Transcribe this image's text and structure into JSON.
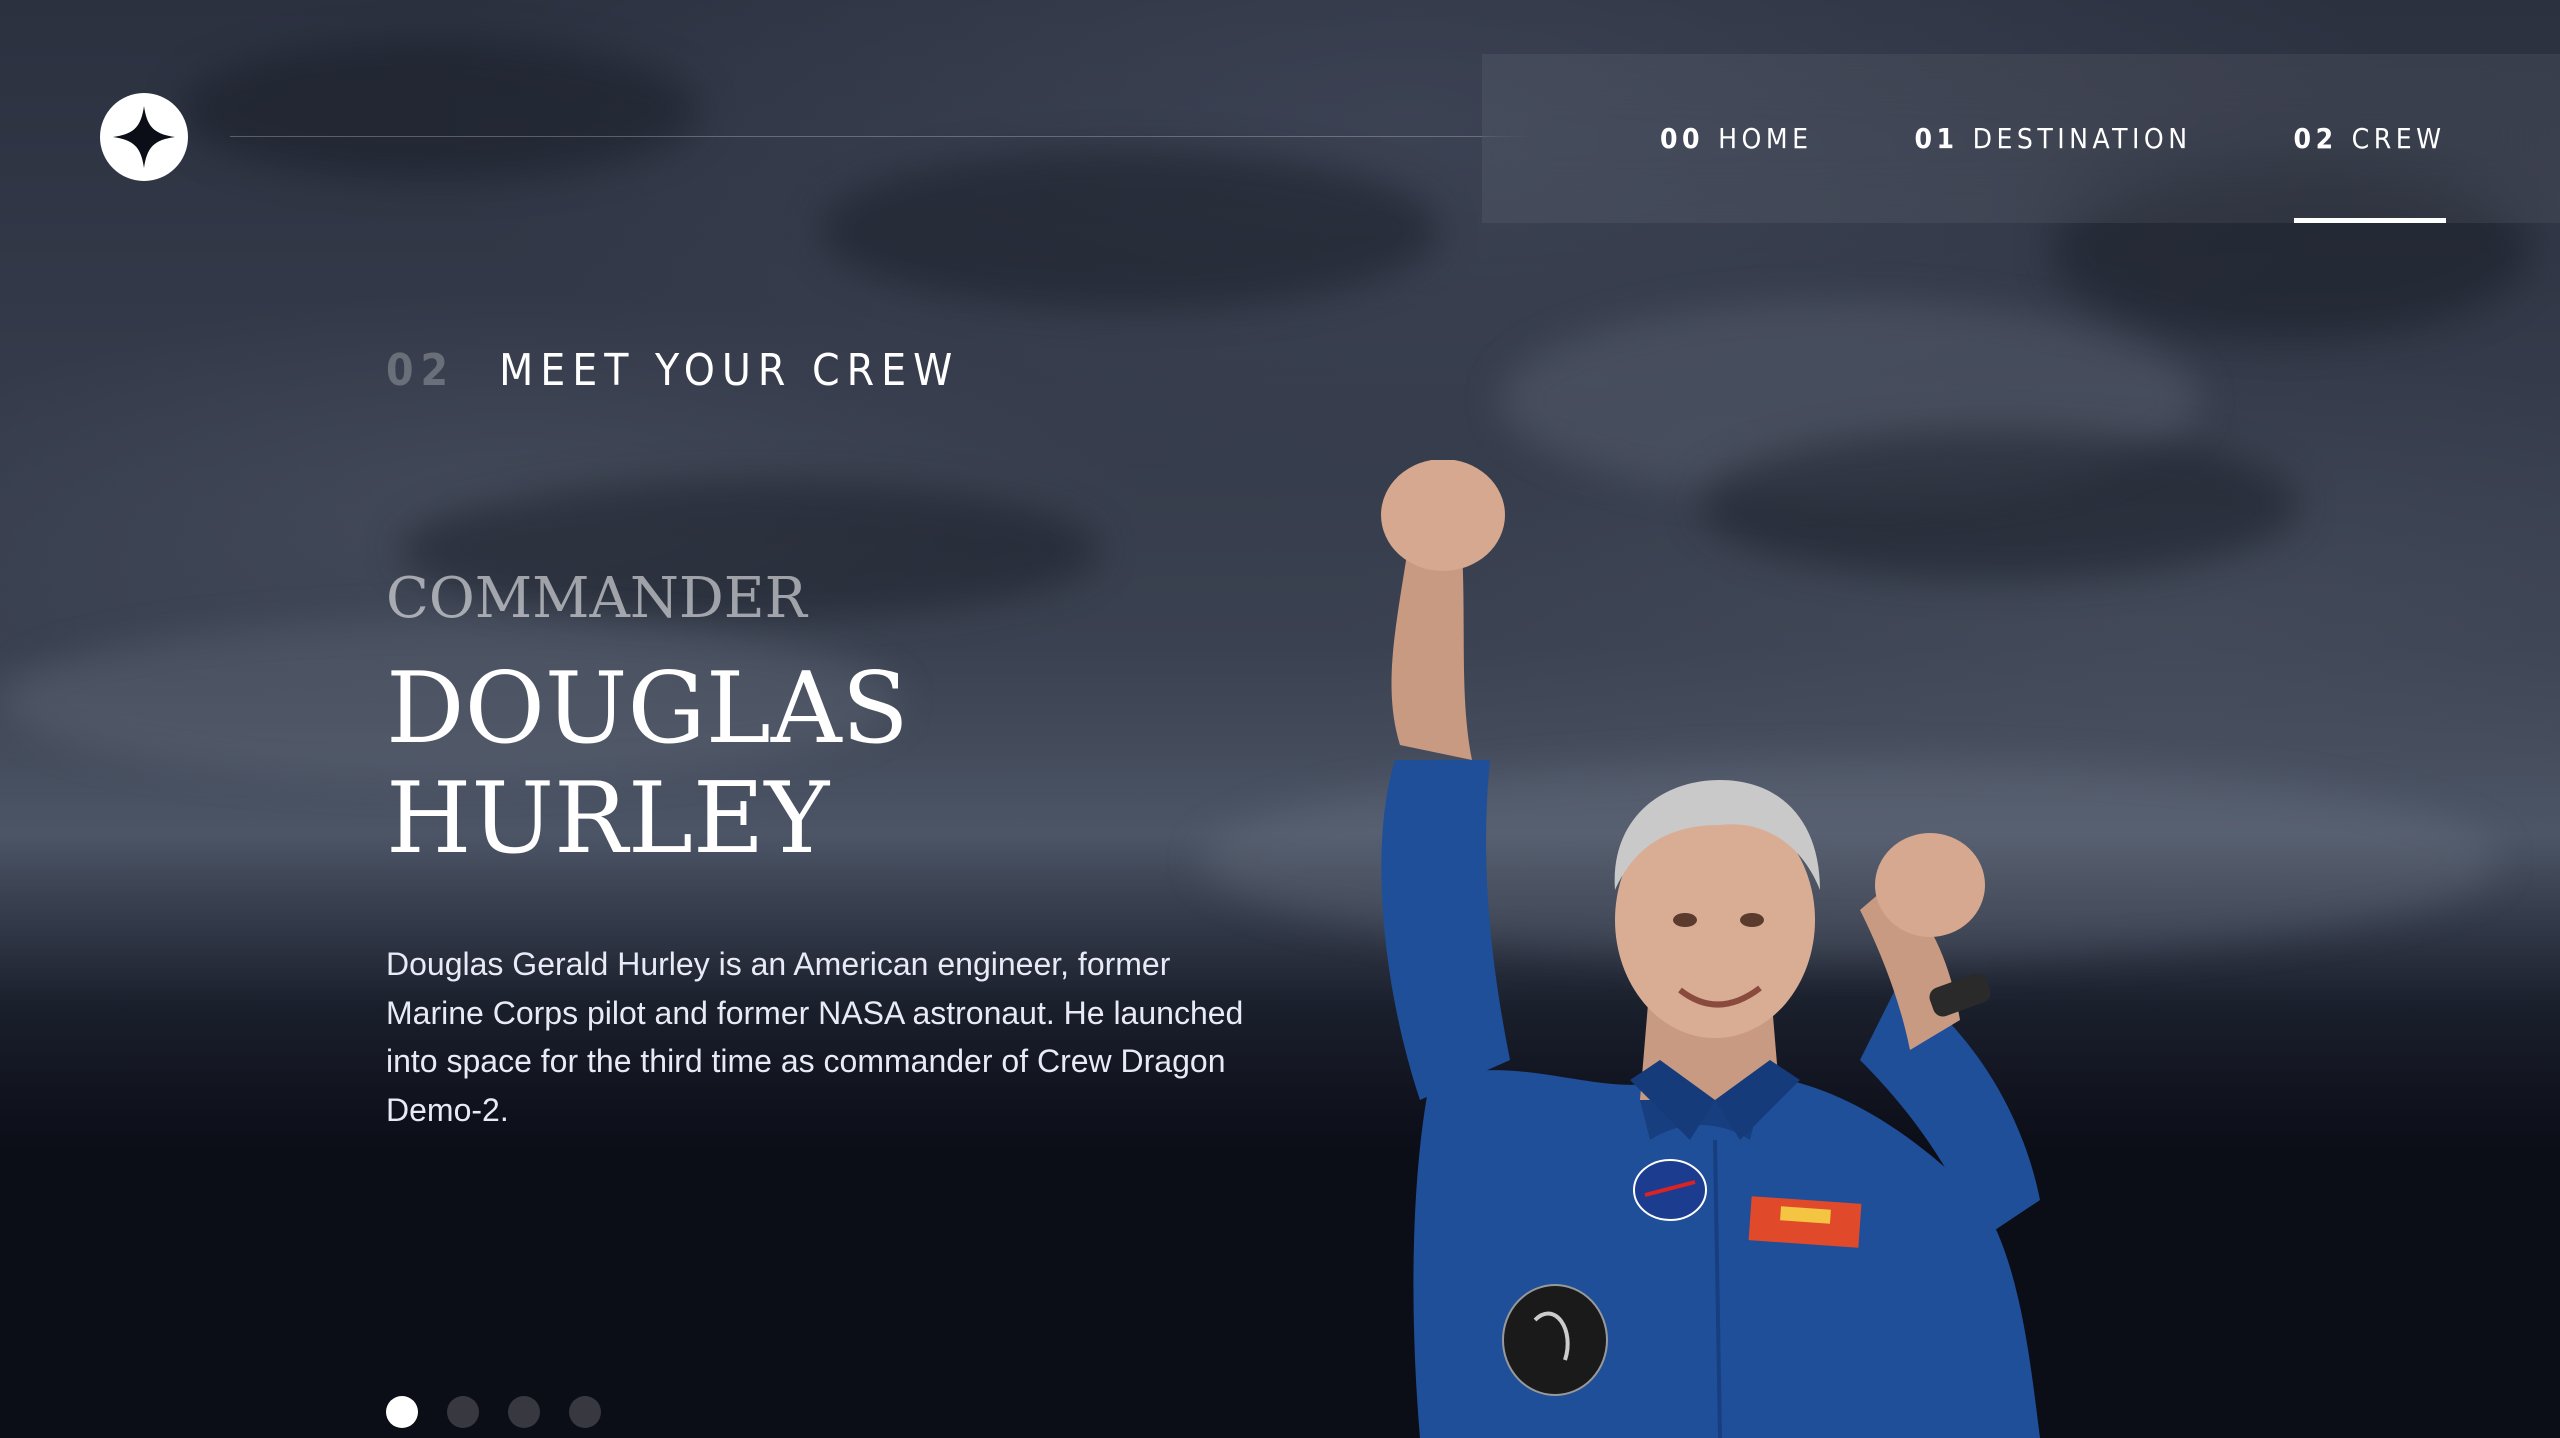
{
  "header": {
    "logo_icon": "star-logo-icon",
    "nav": [
      {
        "num": "00",
        "label": "HOME",
        "active": false
      },
      {
        "num": "01",
        "label": "DESTINATION",
        "active": false
      },
      {
        "num": "02",
        "label": "CREW",
        "active": true
      }
    ]
  },
  "main": {
    "heading": {
      "num": "02",
      "label": "MEET YOUR CREW"
    },
    "crew": {
      "role": "Commander",
      "name_line1": "Douglas",
      "name_line2": "Hurley",
      "bio": "Douglas Gerald Hurley is an American engineer, former Marine Corps pilot and former NASA astronaut. He launched into space for the third time as commander of Crew Dragon Demo-2."
    },
    "pagination": {
      "count": 4,
      "active_index": 0
    }
  },
  "colors": {
    "background": "#0b0d17",
    "text": "#ffffff",
    "accent_suit": "#1f4f99"
  }
}
